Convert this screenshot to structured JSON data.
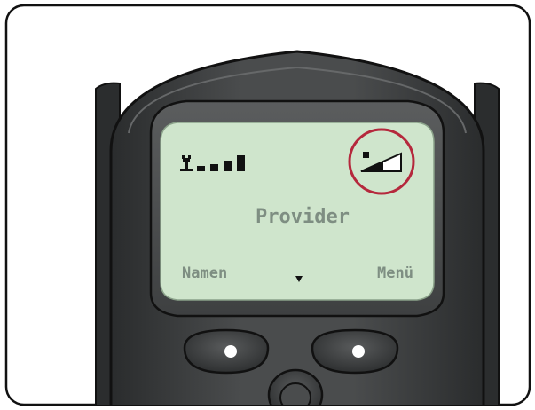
{
  "screen": {
    "center_text": "Provider",
    "left_softkey": "Namen",
    "right_softkey": "Menü",
    "nav_indicator": "down-arrow",
    "signal_icon": "signal-strength-icon",
    "battery_icon": "battery-level-icon",
    "highlight": "battery-level-icon"
  },
  "colors": {
    "lcd_background": "#cfe5cc",
    "lcd_text": "#7e8e82",
    "phone_body": "#3a3c3d",
    "highlight_circle": "#b5283c"
  }
}
